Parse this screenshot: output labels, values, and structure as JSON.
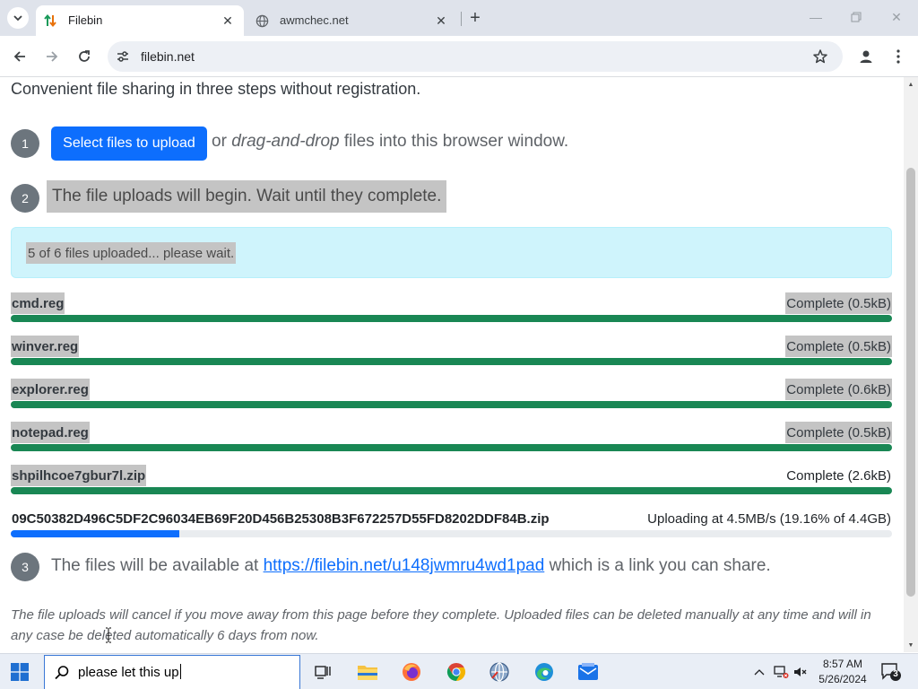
{
  "browser": {
    "tabs": [
      {
        "title": "Filebin",
        "active": true,
        "favicon": "filebin-arrows-icon"
      },
      {
        "title": "awmchec.net",
        "active": false,
        "favicon": "globe-icon"
      }
    ],
    "new_tab_symbol": "+",
    "address": "filebin.net",
    "accent": "#0d6efd"
  },
  "page": {
    "tagline": "Convenient file sharing in three steps without registration.",
    "steps": {
      "one": {
        "number": "1",
        "button_label": "Select files to upload",
        "text_prefix": "or",
        "text_em": "drag-and-drop",
        "text_suffix": "files into this browser window."
      },
      "two": {
        "number": "2",
        "text": "The file uploads will begin. Wait until they complete."
      },
      "three": {
        "number": "3",
        "text_prefix": "The files will be available at",
        "link": "https://filebin.net/u148jwmru4wd1pad",
        "text_suffix": "which is a link you can share."
      }
    },
    "status": "5 of 6 files uploaded... please wait.",
    "files": [
      {
        "name": "cmd.reg",
        "status": "Complete (0.5kB)",
        "progress": 1.0
      },
      {
        "name": "winver.reg",
        "status": "Complete (0.5kB)",
        "progress": 1.0
      },
      {
        "name": "explorer.reg",
        "status": "Complete (0.6kB)",
        "progress": 1.0
      },
      {
        "name": "notepad.reg",
        "status": "Complete (0.5kB)",
        "progress": 1.0
      },
      {
        "name": "shpilhcoe7gbur7l.zip",
        "status": "Complete (2.6kB)",
        "progress": 1.0
      },
      {
        "name": "09C50382D496C5DF2C96034EB69F20D456B25308B3F672257D55FD8202DDF84B.zip",
        "status": "Uploading at 4.5MB/s (19.16% of 4.4GB)",
        "progress": 0.1916
      }
    ],
    "note": "The file uploads will cancel if you move away from this page before they complete. Uploaded files can be deleted manually at any time and will in any case be deleted automatically 6 days from now."
  },
  "taskbar": {
    "search_value": "please let this up",
    "time": "8:57 AM",
    "date": "5/26/2024",
    "notification_count": "3"
  }
}
